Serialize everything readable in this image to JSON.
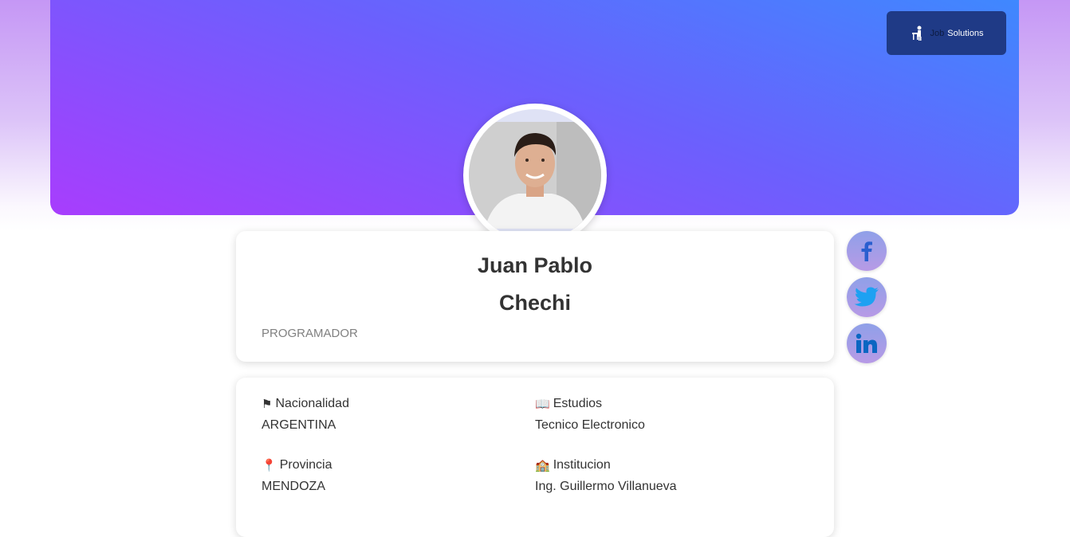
{
  "brand": {
    "word1": "Job",
    "word2": "Solutions"
  },
  "profile": {
    "first_name": "Juan Pablo",
    "last_name": "Chechi",
    "role": "PROGRAMADOR"
  },
  "socials": [
    {
      "icon": "facebook-icon",
      "color": "#1877f2"
    },
    {
      "icon": "twitter-icon",
      "color": "#1da1f2"
    },
    {
      "icon": "linkedin-icon",
      "color": "#0a66c2"
    }
  ],
  "info": {
    "nacionalidad": {
      "icon": "flag-icon",
      "glyph": "⚑",
      "label": "Nacionalidad",
      "value": "ARGENTINA"
    },
    "estudios": {
      "icon": "book-icon",
      "glyph": "📖",
      "label": "Estudios",
      "value": "Tecnico Electronico"
    },
    "provincia": {
      "icon": "map-pin-icon",
      "glyph": "📍",
      "label": "Provincia",
      "value": "MENDOZA"
    },
    "institucion": {
      "icon": "school-icon",
      "glyph": "🏫",
      "label": "Institucion",
      "value": "Ing. Guillermo Villanueva"
    }
  },
  "colors": {
    "hero_start": "#a83dfd",
    "hero_end": "#3f88fe",
    "badge_bg": "#1f3a86",
    "text": "#333333",
    "muted": "#808080"
  }
}
